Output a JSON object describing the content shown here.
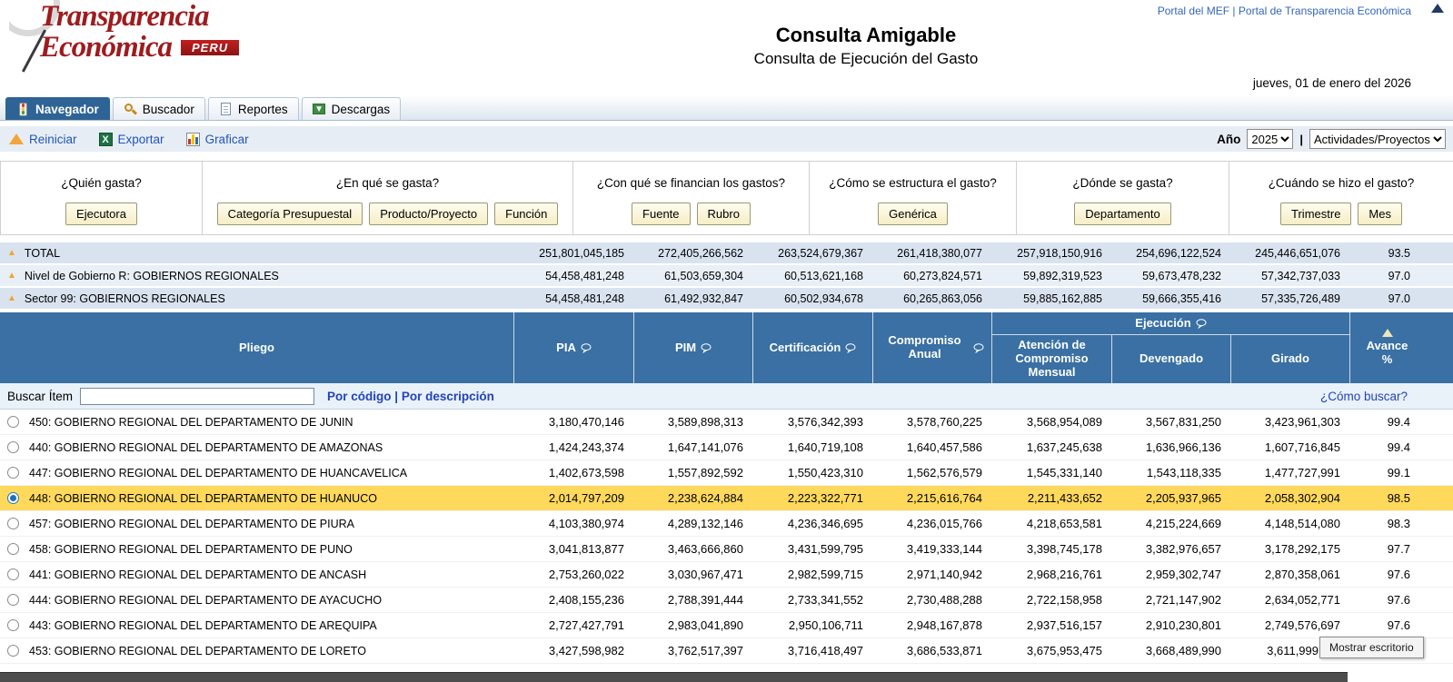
{
  "page": {
    "logo_line1": "Transparencia",
    "logo_line2": "Económica",
    "logo_badge": "PERU",
    "link_mef": "Portal del MEF",
    "link_sep": "|",
    "link_portal": "Portal de Transparencia Económica",
    "title": "Consulta Amigable",
    "subtitle": "Consulta de Ejecución del Gasto",
    "date": "jueves, 01 de enero del 2026"
  },
  "tabs": [
    {
      "label": "Navegador",
      "active": true
    },
    {
      "label": "Buscador",
      "active": false
    },
    {
      "label": "Reportes",
      "active": false
    },
    {
      "label": "Descargas",
      "active": false
    }
  ],
  "toolbar": {
    "reiniciar": "Reiniciar",
    "exportar": "Exportar",
    "graficar": "Graficar",
    "year_label": "Año",
    "year_value": "2025",
    "separator": "|",
    "type_value": "Actividades/Proyectos"
  },
  "query_groups": [
    {
      "question": "¿Quién gasta?",
      "buttons": [
        "Ejecutora"
      ]
    },
    {
      "question": "¿En qué se gasta?",
      "buttons": [
        "Categoría Presupuestal",
        "Producto/Proyecto",
        "Función"
      ]
    },
    {
      "question": "¿Con qué se financian los gastos?",
      "buttons": [
        "Fuente",
        "Rubro"
      ]
    },
    {
      "question": "¿Cómo se estructura el gasto?",
      "buttons": [
        "Genérica"
      ]
    },
    {
      "question": "¿Dónde se gasta?",
      "buttons": [
        "Departamento"
      ]
    },
    {
      "question": "¿Cuándo se hizo el gasto?",
      "buttons": [
        "Trimestre",
        "Mes"
      ]
    }
  ],
  "summary_rows": [
    {
      "label": "TOTAL",
      "values": [
        "251,801,045,185",
        "272,405,266,562",
        "263,524,679,367",
        "261,418,380,077",
        "257,918,150,916",
        "254,696,122,524",
        "245,446,651,076",
        "93.5"
      ]
    },
    {
      "label": "Nivel de Gobierno R: GOBIERNOS REGIONALES",
      "values": [
        "54,458,481,248",
        "61,503,659,304",
        "60,513,621,168",
        "60,273,824,571",
        "59,892,319,523",
        "59,673,478,232",
        "57,342,737,033",
        "97.0"
      ]
    },
    {
      "label": "Sector 99: GOBIERNOS REGIONALES",
      "values": [
        "54,458,481,248",
        "61,492,932,847",
        "60,502,934,678",
        "60,265,863,056",
        "59,885,162,885",
        "59,666,355,416",
        "57,335,726,489",
        "97.0"
      ]
    }
  ],
  "table_header": {
    "pliego": "Pliego",
    "pia": "PIA",
    "pim": "PIM",
    "certificacion": "Certificación",
    "compromiso": "Compromiso Anual",
    "ejecucion": "Ejecución",
    "atencion": "Atención de Compromiso Mensual",
    "devengado": "Devengado",
    "girado": "Girado",
    "avance": "Avance %"
  },
  "search": {
    "label": "Buscar Ítem",
    "input_value": "",
    "by_code": "Por código",
    "sep": "|",
    "by_desc": "Por descripción",
    "help": "¿Cómo buscar?"
  },
  "rows": [
    {
      "selected": false,
      "label": "450: GOBIERNO REGIONAL DEL DEPARTAMENTO DE JUNIN",
      "values": [
        "3,180,470,146",
        "3,589,898,313",
        "3,576,342,393",
        "3,578,760,225",
        "3,568,954,089",
        "3,567,831,250",
        "3,423,961,303",
        "99.4"
      ]
    },
    {
      "selected": false,
      "label": "440: GOBIERNO REGIONAL DEL DEPARTAMENTO DE AMAZONAS",
      "values": [
        "1,424,243,374",
        "1,647,141,076",
        "1,640,719,108",
        "1,640,457,586",
        "1,637,245,638",
        "1,636,966,136",
        "1,607,716,845",
        "99.4"
      ]
    },
    {
      "selected": false,
      "label": "447: GOBIERNO REGIONAL DEL DEPARTAMENTO DE HUANCAVELICA",
      "values": [
        "1,402,673,598",
        "1,557,892,592",
        "1,550,423,310",
        "1,562,576,579",
        "1,545,331,140",
        "1,543,118,335",
        "1,477,727,991",
        "99.1"
      ]
    },
    {
      "selected": true,
      "label": "448: GOBIERNO REGIONAL DEL DEPARTAMENTO DE HUANUCO",
      "values": [
        "2,014,797,209",
        "2,238,624,884",
        "2,223,322,771",
        "2,215,616,764",
        "2,211,433,652",
        "2,205,937,965",
        "2,058,302,904",
        "98.5"
      ]
    },
    {
      "selected": false,
      "label": "457: GOBIERNO REGIONAL DEL DEPARTAMENTO DE PIURA",
      "values": [
        "4,103,380,974",
        "4,289,132,146",
        "4,236,346,695",
        "4,236,015,766",
        "4,218,653,581",
        "4,215,224,669",
        "4,148,514,080",
        "98.3"
      ]
    },
    {
      "selected": false,
      "label": "458: GOBIERNO REGIONAL DEL DEPARTAMENTO DE PUNO",
      "values": [
        "3,041,813,877",
        "3,463,666,860",
        "3,431,599,795",
        "3,419,333,144",
        "3,398,745,178",
        "3,382,976,657",
        "3,178,292,175",
        "97.7"
      ]
    },
    {
      "selected": false,
      "label": "441: GOBIERNO REGIONAL DEL DEPARTAMENTO DE ANCASH",
      "values": [
        "2,753,260,022",
        "3,030,967,471",
        "2,982,599,715",
        "2,971,140,942",
        "2,968,216,761",
        "2,959,302,747",
        "2,870,358,061",
        "97.6"
      ]
    },
    {
      "selected": false,
      "label": "444: GOBIERNO REGIONAL DEL DEPARTAMENTO DE AYACUCHO",
      "values": [
        "2,408,155,236",
        "2,788,391,444",
        "2,733,341,552",
        "2,730,488,288",
        "2,722,158,958",
        "2,721,147,902",
        "2,634,052,771",
        "97.6"
      ]
    },
    {
      "selected": false,
      "label": "443: GOBIERNO REGIONAL DEL DEPARTAMENTO DE AREQUIPA",
      "values": [
        "2,727,427,791",
        "2,983,041,890",
        "2,950,106,711",
        "2,948,167,878",
        "2,937,516,157",
        "2,910,230,801",
        "2,749,576,697",
        "97.6"
      ]
    },
    {
      "selected": false,
      "label": "453: GOBIERNO REGIONAL DEL DEPARTAMENTO DE LORETO",
      "values": [
        "3,427,598,982",
        "3,762,517,397",
        "3,716,418,497",
        "3,686,533,871",
        "3,675,953,475",
        "3,668,489,990",
        "3,611,999",
        ""
      ]
    }
  ],
  "overlay": {
    "tooltip": "Mostrar escritorio"
  }
}
